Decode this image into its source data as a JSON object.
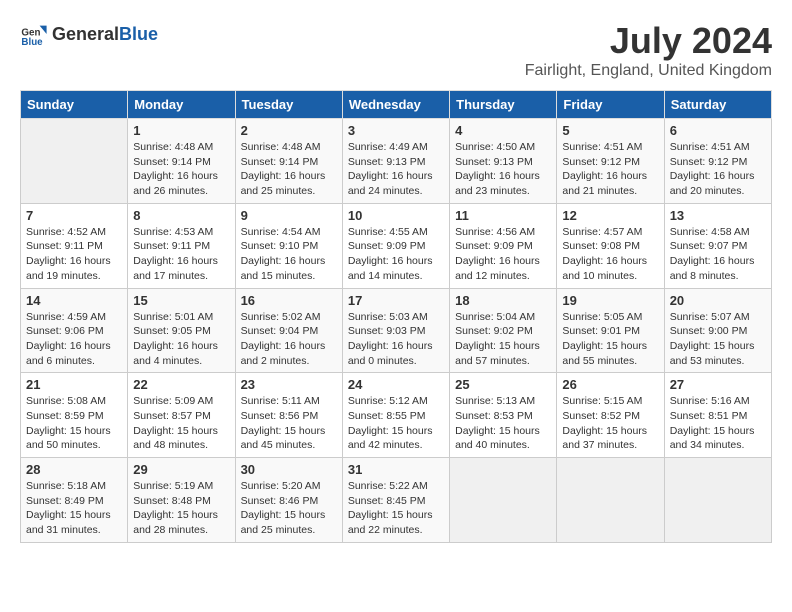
{
  "header": {
    "logo_general": "General",
    "logo_blue": "Blue",
    "title": "July 2024",
    "subtitle": "Fairlight, England, United Kingdom"
  },
  "columns": [
    "Sunday",
    "Monday",
    "Tuesday",
    "Wednesday",
    "Thursday",
    "Friday",
    "Saturday"
  ],
  "weeks": [
    [
      {
        "day": "",
        "sunrise": "",
        "sunset": "",
        "daylight": ""
      },
      {
        "day": "1",
        "sunrise": "Sunrise: 4:48 AM",
        "sunset": "Sunset: 9:14 PM",
        "daylight": "Daylight: 16 hours and 26 minutes."
      },
      {
        "day": "2",
        "sunrise": "Sunrise: 4:48 AM",
        "sunset": "Sunset: 9:14 PM",
        "daylight": "Daylight: 16 hours and 25 minutes."
      },
      {
        "day": "3",
        "sunrise": "Sunrise: 4:49 AM",
        "sunset": "Sunset: 9:13 PM",
        "daylight": "Daylight: 16 hours and 24 minutes."
      },
      {
        "day": "4",
        "sunrise": "Sunrise: 4:50 AM",
        "sunset": "Sunset: 9:13 PM",
        "daylight": "Daylight: 16 hours and 23 minutes."
      },
      {
        "day": "5",
        "sunrise": "Sunrise: 4:51 AM",
        "sunset": "Sunset: 9:12 PM",
        "daylight": "Daylight: 16 hours and 21 minutes."
      },
      {
        "day": "6",
        "sunrise": "Sunrise: 4:51 AM",
        "sunset": "Sunset: 9:12 PM",
        "daylight": "Daylight: 16 hours and 20 minutes."
      }
    ],
    [
      {
        "day": "7",
        "sunrise": "Sunrise: 4:52 AM",
        "sunset": "Sunset: 9:11 PM",
        "daylight": "Daylight: 16 hours and 19 minutes."
      },
      {
        "day": "8",
        "sunrise": "Sunrise: 4:53 AM",
        "sunset": "Sunset: 9:11 PM",
        "daylight": "Daylight: 16 hours and 17 minutes."
      },
      {
        "day": "9",
        "sunrise": "Sunrise: 4:54 AM",
        "sunset": "Sunset: 9:10 PM",
        "daylight": "Daylight: 16 hours and 15 minutes."
      },
      {
        "day": "10",
        "sunrise": "Sunrise: 4:55 AM",
        "sunset": "Sunset: 9:09 PM",
        "daylight": "Daylight: 16 hours and 14 minutes."
      },
      {
        "day": "11",
        "sunrise": "Sunrise: 4:56 AM",
        "sunset": "Sunset: 9:09 PM",
        "daylight": "Daylight: 16 hours and 12 minutes."
      },
      {
        "day": "12",
        "sunrise": "Sunrise: 4:57 AM",
        "sunset": "Sunset: 9:08 PM",
        "daylight": "Daylight: 16 hours and 10 minutes."
      },
      {
        "day": "13",
        "sunrise": "Sunrise: 4:58 AM",
        "sunset": "Sunset: 9:07 PM",
        "daylight": "Daylight: 16 hours and 8 minutes."
      }
    ],
    [
      {
        "day": "14",
        "sunrise": "Sunrise: 4:59 AM",
        "sunset": "Sunset: 9:06 PM",
        "daylight": "Daylight: 16 hours and 6 minutes."
      },
      {
        "day": "15",
        "sunrise": "Sunrise: 5:01 AM",
        "sunset": "Sunset: 9:05 PM",
        "daylight": "Daylight: 16 hours and 4 minutes."
      },
      {
        "day": "16",
        "sunrise": "Sunrise: 5:02 AM",
        "sunset": "Sunset: 9:04 PM",
        "daylight": "Daylight: 16 hours and 2 minutes."
      },
      {
        "day": "17",
        "sunrise": "Sunrise: 5:03 AM",
        "sunset": "Sunset: 9:03 PM",
        "daylight": "Daylight: 16 hours and 0 minutes."
      },
      {
        "day": "18",
        "sunrise": "Sunrise: 5:04 AM",
        "sunset": "Sunset: 9:02 PM",
        "daylight": "Daylight: 15 hours and 57 minutes."
      },
      {
        "day": "19",
        "sunrise": "Sunrise: 5:05 AM",
        "sunset": "Sunset: 9:01 PM",
        "daylight": "Daylight: 15 hours and 55 minutes."
      },
      {
        "day": "20",
        "sunrise": "Sunrise: 5:07 AM",
        "sunset": "Sunset: 9:00 PM",
        "daylight": "Daylight: 15 hours and 53 minutes."
      }
    ],
    [
      {
        "day": "21",
        "sunrise": "Sunrise: 5:08 AM",
        "sunset": "Sunset: 8:59 PM",
        "daylight": "Daylight: 15 hours and 50 minutes."
      },
      {
        "day": "22",
        "sunrise": "Sunrise: 5:09 AM",
        "sunset": "Sunset: 8:57 PM",
        "daylight": "Daylight: 15 hours and 48 minutes."
      },
      {
        "day": "23",
        "sunrise": "Sunrise: 5:11 AM",
        "sunset": "Sunset: 8:56 PM",
        "daylight": "Daylight: 15 hours and 45 minutes."
      },
      {
        "day": "24",
        "sunrise": "Sunrise: 5:12 AM",
        "sunset": "Sunset: 8:55 PM",
        "daylight": "Daylight: 15 hours and 42 minutes."
      },
      {
        "day": "25",
        "sunrise": "Sunrise: 5:13 AM",
        "sunset": "Sunset: 8:53 PM",
        "daylight": "Daylight: 15 hours and 40 minutes."
      },
      {
        "day": "26",
        "sunrise": "Sunrise: 5:15 AM",
        "sunset": "Sunset: 8:52 PM",
        "daylight": "Daylight: 15 hours and 37 minutes."
      },
      {
        "day": "27",
        "sunrise": "Sunrise: 5:16 AM",
        "sunset": "Sunset: 8:51 PM",
        "daylight": "Daylight: 15 hours and 34 minutes."
      }
    ],
    [
      {
        "day": "28",
        "sunrise": "Sunrise: 5:18 AM",
        "sunset": "Sunset: 8:49 PM",
        "daylight": "Daylight: 15 hours and 31 minutes."
      },
      {
        "day": "29",
        "sunrise": "Sunrise: 5:19 AM",
        "sunset": "Sunset: 8:48 PM",
        "daylight": "Daylight: 15 hours and 28 minutes."
      },
      {
        "day": "30",
        "sunrise": "Sunrise: 5:20 AM",
        "sunset": "Sunset: 8:46 PM",
        "daylight": "Daylight: 15 hours and 25 minutes."
      },
      {
        "day": "31",
        "sunrise": "Sunrise: 5:22 AM",
        "sunset": "Sunset: 8:45 PM",
        "daylight": "Daylight: 15 hours and 22 minutes."
      },
      {
        "day": "",
        "sunrise": "",
        "sunset": "",
        "daylight": ""
      },
      {
        "day": "",
        "sunrise": "",
        "sunset": "",
        "daylight": ""
      },
      {
        "day": "",
        "sunrise": "",
        "sunset": "",
        "daylight": ""
      }
    ]
  ]
}
